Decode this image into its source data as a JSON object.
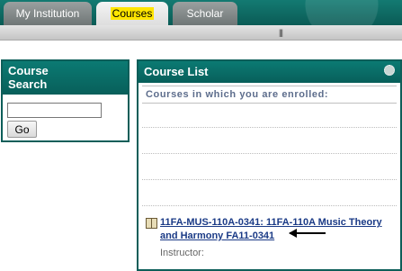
{
  "tabs": [
    {
      "label": "My Institution"
    },
    {
      "label": "Courses"
    },
    {
      "label": "Scholar"
    }
  ],
  "course_search": {
    "title_line1": "Course",
    "title_line2": "Search",
    "input_value": "",
    "go_label": "Go"
  },
  "course_list": {
    "title": "Course List",
    "enrolled_label": "Courses in which you are enrolled:",
    "course_line1": "11FA-MUS-110A-0341: 11FA-110A Music Theory",
    "course_line2": "and Harmony FA11-0341",
    "instructor_label": "Instructor:"
  }
}
